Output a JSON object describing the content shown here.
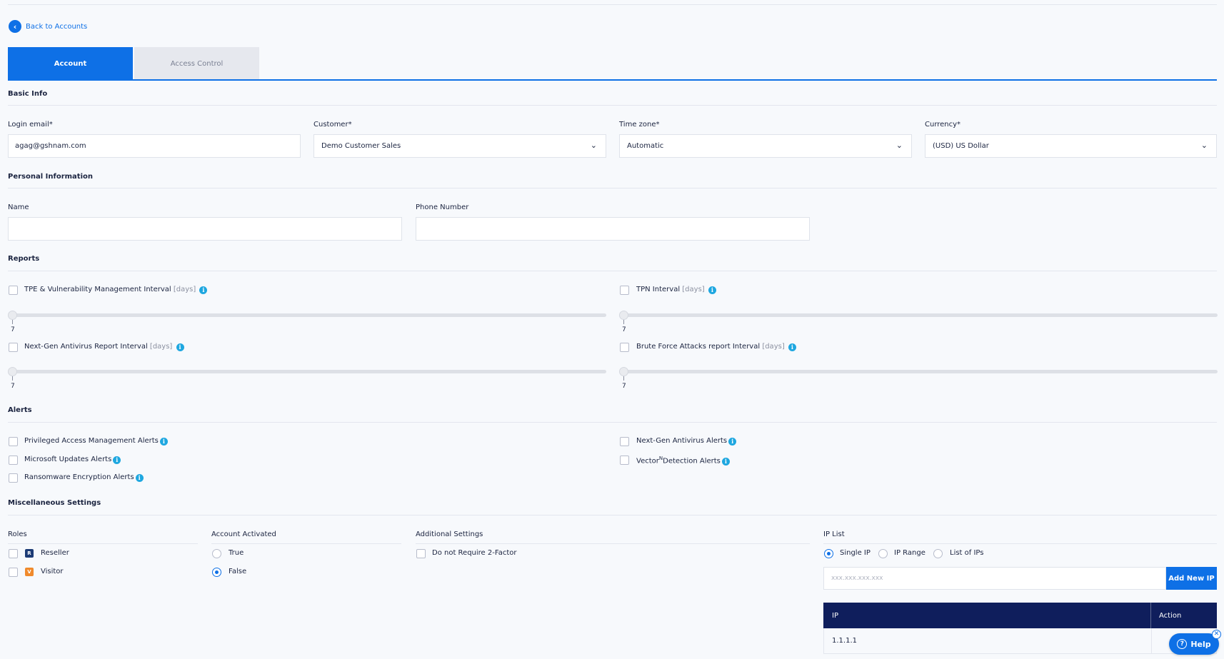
{
  "nav": {
    "back_label": "Back to Accounts"
  },
  "tabs": [
    {
      "label": "Account"
    },
    {
      "label": "Access Control"
    }
  ],
  "basic_info": {
    "title": "Basic Info",
    "login_email_label": "Login email*",
    "login_email_value": "agag@gshnam.com",
    "customer_label": "Customer*",
    "customer_value": "Demo Customer Sales",
    "timezone_label": "Time zone*",
    "timezone_value": "Automatic",
    "currency_label": "Currency*",
    "currency_value": "(USD) US Dollar"
  },
  "personal": {
    "title": "Personal Information",
    "name_label": "Name",
    "name_value": "",
    "phone_label": "Phone Number",
    "phone_value": ""
  },
  "reports": {
    "title": "Reports",
    "items": [
      {
        "label": "TPE & Vulnerability Management Interval",
        "unit": "[days]",
        "value": "7"
      },
      {
        "label": "TPN Interval",
        "unit": "[days]",
        "value": "7"
      },
      {
        "label": "Next-Gen Antivirus Report Interval",
        "unit": "[days]",
        "value": "7"
      },
      {
        "label": "Brute Force Attacks report Interval",
        "unit": "[days]",
        "value": "7"
      }
    ]
  },
  "alerts": {
    "title": "Alerts",
    "items": [
      {
        "label": "Privileged Access Management Alerts"
      },
      {
        "label": "Microsoft Updates Alerts"
      },
      {
        "label": "Ransomware Encryption Alerts"
      },
      {
        "label": "Next-Gen Antivirus Alerts"
      },
      {
        "label_a": "Vector",
        "label_sup": "N",
        "label_b": "Detection Alerts"
      }
    ]
  },
  "misc": {
    "title": "Miscellaneous Settings",
    "roles_label": "Roles",
    "roles": [
      {
        "badge": "R",
        "label": "Reseller"
      },
      {
        "badge": "V",
        "label": "Visitor"
      }
    ],
    "activated_label": "Account Activated",
    "activated_options": [
      {
        "label": "True",
        "selected": false
      },
      {
        "label": "False",
        "selected": true
      }
    ],
    "additional_label": "Additional Settings",
    "additional_options": [
      {
        "label": "Do not Require 2-Factor"
      }
    ],
    "ip_list_label": "IP List",
    "ip_modes": [
      {
        "label": "Single IP",
        "selected": true
      },
      {
        "label": "IP Range",
        "selected": false
      },
      {
        "label": "List of IPs",
        "selected": false
      }
    ],
    "ip_placeholder": "xxx.xxx.xxx.xxx",
    "add_button": "Add New IP",
    "table_headers": [
      "IP",
      "Action"
    ],
    "table_rows": [
      {
        "ip": "1.1.1.1"
      }
    ]
  },
  "help": {
    "label": "Help"
  },
  "icons": {
    "back": "chevron-left-icon",
    "dropdown": "chevron-down-icon",
    "info": "info-icon",
    "help": "question-circle-icon",
    "close": "close-icon"
  },
  "colors": {
    "accent": "#0e70e6",
    "table_header": "#0f1e5c",
    "info": "#1ea7e0",
    "reseller_badge": "#1c3b75",
    "visitor_badge": "#f08a2c"
  }
}
